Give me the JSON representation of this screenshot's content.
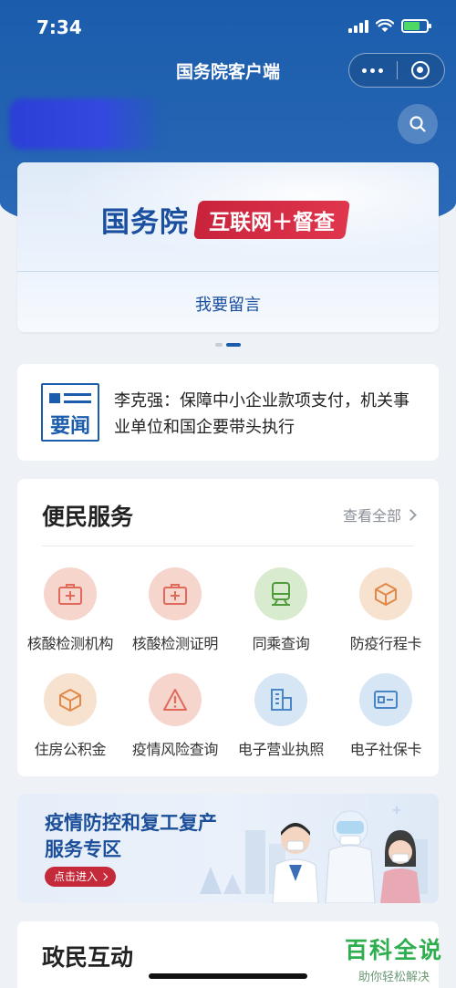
{
  "status_bar": {
    "time": "7:34"
  },
  "nav": {
    "title": "国务院客户端"
  },
  "banner": {
    "brand": "国务院",
    "tag": "互联网＋督查",
    "link": "我要留言"
  },
  "carousel": {
    "count": 2,
    "active": 2
  },
  "news": {
    "badge": "要闻",
    "headline": "李克强：保障中小企业款项支付，机关事业单位和国企要带头执行"
  },
  "services": {
    "title": "便民服务",
    "more": "查看全部",
    "items": [
      {
        "label": "核酸检测机构",
        "icon": "medical-kit-icon",
        "color": "#f5d5cc"
      },
      {
        "label": "核酸检测证明",
        "icon": "medical-kit-icon",
        "color": "#f5d5cc"
      },
      {
        "label": "同乘查询",
        "icon": "train-icon",
        "color": "#d9ebcf"
      },
      {
        "label": "防疫行程卡",
        "icon": "box-icon",
        "color": "#f7e2cf"
      },
      {
        "label": "住房公积金",
        "icon": "box-icon",
        "color": "#f7e2cf"
      },
      {
        "label": "疫情风险查询",
        "icon": "warning-icon",
        "color": "#f5d5cc"
      },
      {
        "label": "电子营业执照",
        "icon": "building-icon",
        "color": "#d6e6f4"
      },
      {
        "label": "电子社保卡",
        "icon": "id-card-icon",
        "color": "#d6e6f4"
      }
    ]
  },
  "promo": {
    "line1": "疫情防控和复工复产",
    "line2": "服务专区",
    "button": "点击进入"
  },
  "interaction": {
    "title": "政民互动"
  },
  "watermark": {
    "big": "百科全说",
    "small": "助你轻松解决"
  }
}
